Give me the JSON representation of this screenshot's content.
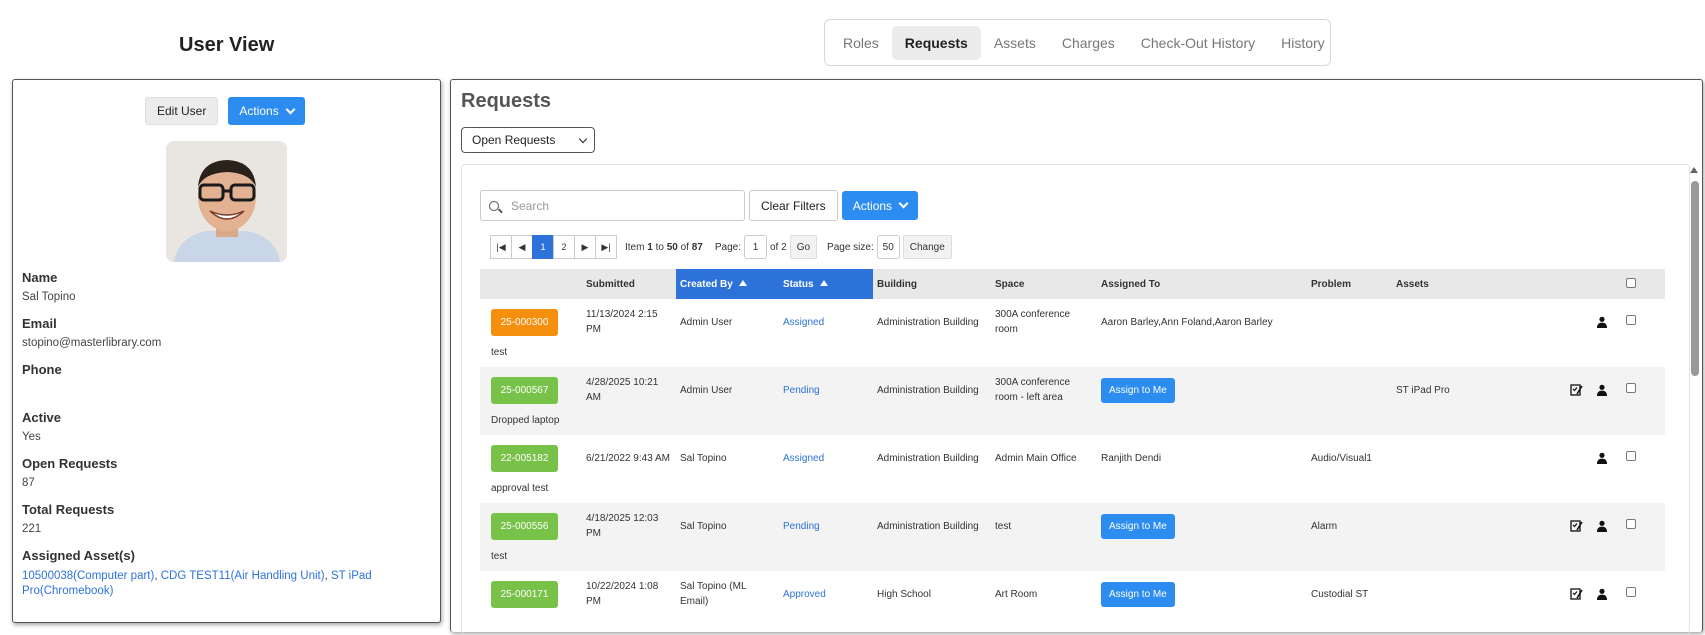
{
  "page": {
    "title": "User View"
  },
  "tabs": [
    "Roles",
    "Requests",
    "Assets",
    "Charges",
    "Check-Out History",
    "History"
  ],
  "active_tab": "Requests",
  "user": {
    "edit_label": "Edit User",
    "actions_label": "Actions",
    "fields": [
      {
        "label": "Name",
        "value": "Sal Topino"
      },
      {
        "label": "Email",
        "value": "stopino@masterlibrary.com"
      },
      {
        "label": "Phone",
        "value": ""
      },
      {
        "label": "Active",
        "value": "Yes"
      },
      {
        "label": "Open Requests",
        "value": "87"
      },
      {
        "label": "Total Requests",
        "value": "221"
      }
    ],
    "assets_label": "Assigned Asset(s)",
    "assets": [
      "10500038(Computer part)",
      "CDG TEST11(Air Handling Unit)",
      "ST iPad Pro(Chromebook)"
    ],
    "asset_separator": ", "
  },
  "requests": {
    "title": "Requests",
    "filter_selected": "Open Requests",
    "search_placeholder": "Search",
    "clear_filters_label": "Clear Filters",
    "actions_label": "Actions",
    "pager": {
      "pages": [
        "1",
        "2"
      ],
      "current_page": "1",
      "item_prefix": "Item",
      "item_from": "1",
      "item_to_word": "to",
      "item_to": "50",
      "item_of_word": "of",
      "item_total": "87",
      "page_label": "Page:",
      "page_value": "1",
      "page_of": "of 2",
      "go_label": "Go",
      "page_size_label": "Page size:",
      "page_size_value": "50",
      "change_label": "Change"
    },
    "columns": [
      "",
      "Submitted",
      "Created By",
      "Status",
      "Building",
      "Space",
      "Assigned To",
      "Problem",
      "Assets",
      "",
      ""
    ],
    "rows": [
      {
        "id": "25-000300",
        "color": "#f58f0e",
        "submitted": "11/13/2024 2:15 PM",
        "created_by": "Admin User",
        "status": "Assigned",
        "building": "Administration Building",
        "space": "300A conference room",
        "assigned_to": "Aaron Barley,Ann Foland,Aaron Barley",
        "problem": "",
        "assets": "",
        "note": "test",
        "edit_icon": false
      },
      {
        "id": "25-000567",
        "color": "#79c24a",
        "submitted": "4/28/2025 10:21 AM",
        "created_by": "Admin User",
        "status": "Pending",
        "building": "Administration Building",
        "space": "300A conference room - left area",
        "assigned_to": "",
        "problem": "",
        "assets": "ST iPad Pro",
        "note": "Dropped laptop",
        "edit_icon": true
      },
      {
        "id": "22-005182",
        "color": "#79c24a",
        "submitted": "6/21/2022 9:43 AM",
        "created_by": "Sal Topino",
        "status": "Assigned",
        "building": "Administration Building",
        "space": "Admin Main Office",
        "assigned_to": "Ranjith Dendi",
        "problem": "Audio/Visual1",
        "assets": "",
        "note": "approval test",
        "edit_icon": false
      },
      {
        "id": "25-000556",
        "color": "#79c24a",
        "submitted": "4/18/2025 12:03 PM",
        "created_by": "Sal Topino",
        "status": "Pending",
        "building": "Administration Building",
        "space": "test",
        "assigned_to": "",
        "problem": "Alarm",
        "assets": "",
        "note": "test",
        "edit_icon": true
      },
      {
        "id": "25-000171",
        "color": "#79c24a",
        "submitted": "10/22/2024 1:08 PM",
        "created_by": "Sal Topino (ML Email)",
        "status": "Approved",
        "building": "High School",
        "space": "Art Room",
        "assigned_to": "",
        "problem": "Custodial ST",
        "assets": "",
        "note": "",
        "edit_icon": true
      }
    ],
    "assign_label": "Assign to Me"
  }
}
